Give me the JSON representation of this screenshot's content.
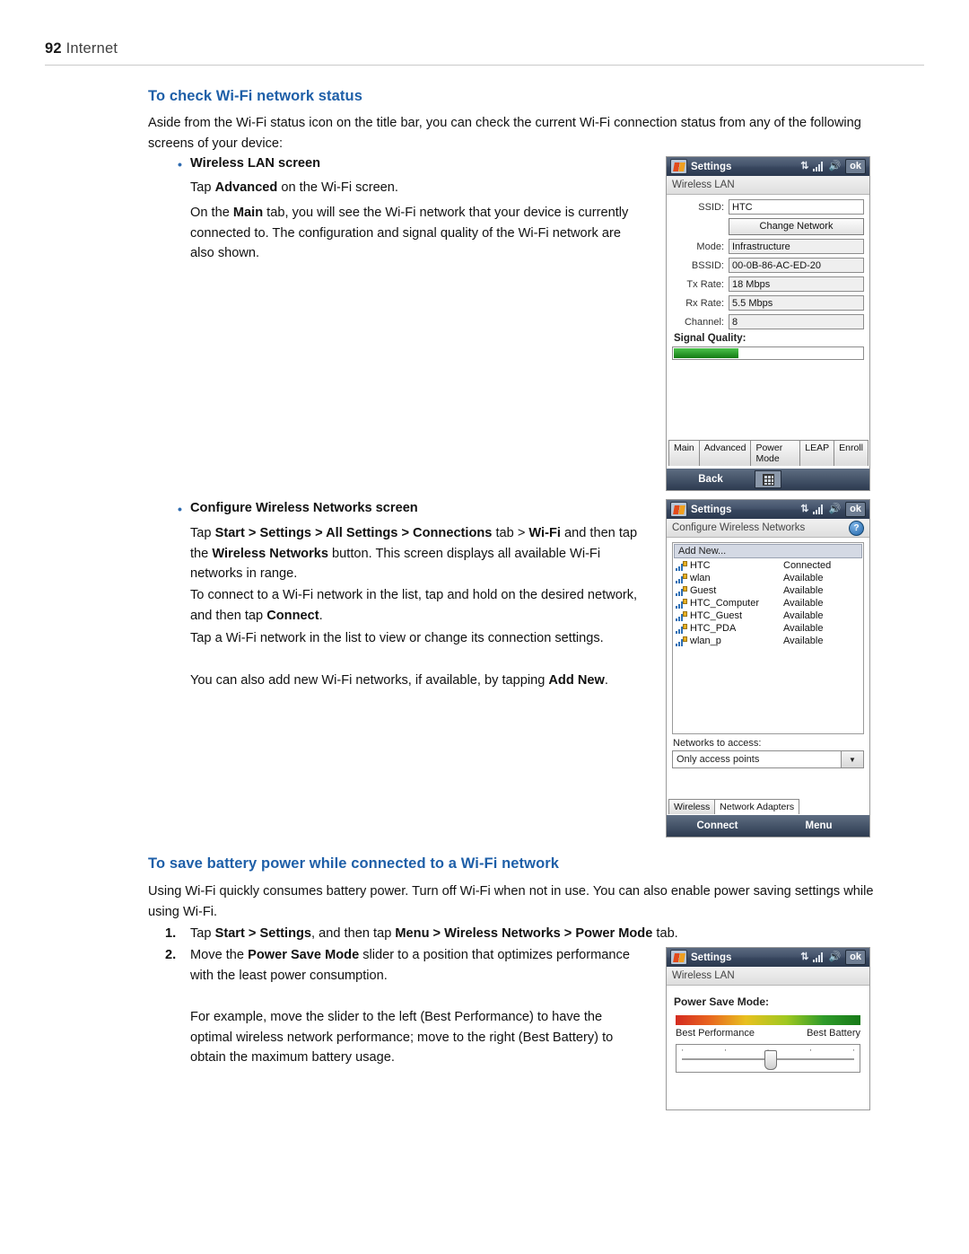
{
  "header": {
    "page_number": "92",
    "section": "Internet"
  },
  "sections": {
    "wifi_status": {
      "heading": "To check Wi-Fi network status",
      "intro": "Aside from the Wi-Fi status icon on the title bar, you can check the current Wi-Fi connection status from any of the following screens of your device:",
      "bullet1": "Wireless LAN screen",
      "b1_p1_a": "Tap ",
      "b1_p1_b": "Advanced",
      "b1_p1_c": " on the Wi-Fi screen.",
      "b1_p2_a": "On the ",
      "b1_p2_b": "Main",
      "b1_p2_c": " tab, you will see the Wi-Fi network that your device is currently connected to. The configuration and signal quality of the Wi-Fi network are also shown.",
      "bullet2": "Configure Wireless Networks screen",
      "b2_p1_a": "Tap ",
      "b2_p1_b": "Start > Settings > All Settings > Connections",
      "b2_p1_c": " tab > ",
      "b2_p1_d": "Wi-Fi",
      "b2_p1_e": " and then tap the ",
      "b2_p1_f": "Wireless Networks",
      "b2_p1_g": " button. This screen displays all available Wi-Fi networks in range.",
      "b2_p2_a": "To connect to a Wi-Fi network in the list, tap and hold on the desired network, and then tap ",
      "b2_p2_b": "Connect",
      "b2_p2_c": ".",
      "b2_p3": "Tap a Wi-Fi network in the list to view or change its connection settings.",
      "b2_p4_a": "You can also add new Wi-Fi networks, if available, by tapping ",
      "b2_p4_b": "Add New",
      "b2_p4_c": "."
    },
    "battery": {
      "heading": "To save battery power while connected to a Wi-Fi network",
      "intro": "Using Wi-Fi quickly consumes battery power. Turn off Wi-Fi when not in use. You can also enable power saving settings while using Wi-Fi.",
      "step1_num": "1.",
      "step1_a": "Tap ",
      "step1_b": "Start > Settings",
      "step1_c": ", and then tap ",
      "step1_d": "Menu > Wireless Networks > Power Mode",
      "step1_e": " tab.",
      "step2_num": "2.",
      "step2_a": "Move the ",
      "step2_b": "Power Save Mode",
      "step2_c": " slider to a position that optimizes performance with the least power consumption.",
      "step2_p2": "For example, move the slider to the left (Best Performance) to have the optimal wireless network performance; move to the right (Best Battery) to obtain the maximum battery usage."
    }
  },
  "screenshot_wireless_lan": {
    "title": "Settings",
    "ok_label": "ok",
    "subtitle": "Wireless LAN",
    "fields": [
      {
        "label": "SSID:",
        "value": "HTC"
      },
      {
        "label": "Mode:",
        "value": "Infrastructure"
      },
      {
        "label": "BSSID:",
        "value": "00-0B-86-AC-ED-20"
      },
      {
        "label": "Tx Rate:",
        "value": "18 Mbps"
      },
      {
        "label": "Rx Rate:",
        "value": "5.5 Mbps"
      },
      {
        "label": "Channel:",
        "value": "8"
      }
    ],
    "change_network_button": "Change Network",
    "signal_quality_label": "Signal Quality:",
    "tabs": [
      "Main",
      "Advanced",
      "Power Mode",
      "LEAP",
      "Enroll"
    ],
    "softkey_left": "Back"
  },
  "screenshot_configure_networks": {
    "title": "Settings",
    "ok_label": "ok",
    "subtitle": "Configure Wireless Networks",
    "help_icon": "?",
    "add_new": "Add New...",
    "networks": [
      {
        "name": "HTC",
        "status": "Connected"
      },
      {
        "name": "wlan",
        "status": "Available"
      },
      {
        "name": "Guest",
        "status": "Available"
      },
      {
        "name": "HTC_Computer",
        "status": "Available"
      },
      {
        "name": "HTC_Guest",
        "status": "Available"
      },
      {
        "name": "HTC_PDA",
        "status": "Available"
      },
      {
        "name": "wlan_p",
        "status": "Available"
      }
    ],
    "networks_to_access_label": "Networks to access:",
    "networks_to_access_value": "Only access points",
    "bottom_tabs": [
      "Wireless",
      "Network Adapters"
    ],
    "softkey_left": "Connect",
    "softkey_right": "Menu"
  },
  "screenshot_power_mode": {
    "title": "Settings",
    "ok_label": "ok",
    "subtitle": "Wireless LAN",
    "power_save_label": "Power Save Mode:",
    "left_end": "Best Performance",
    "right_end": "Best Battery"
  }
}
